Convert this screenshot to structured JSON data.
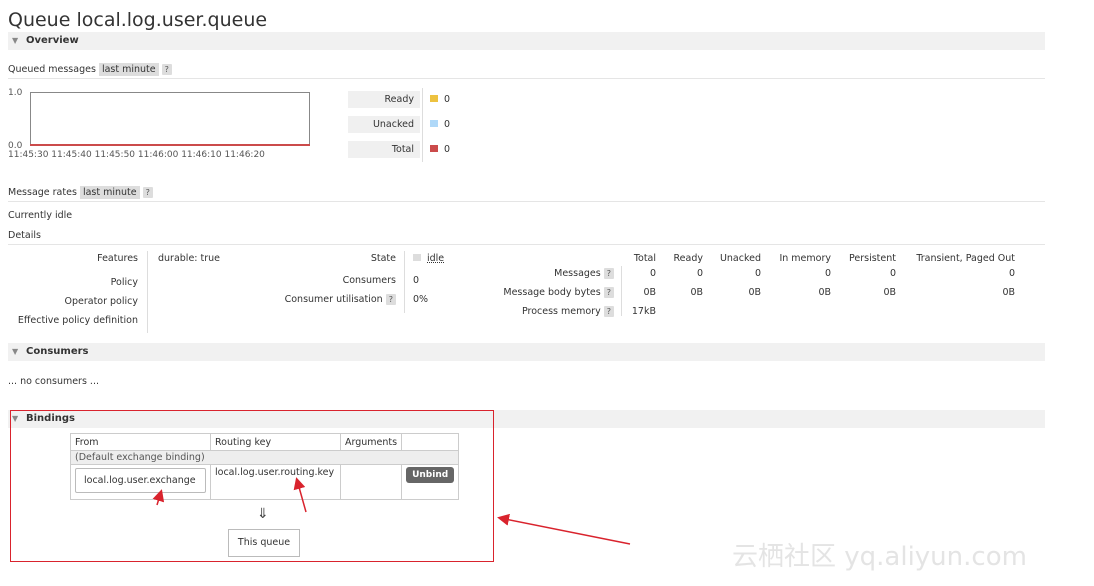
{
  "title_prefix": "Queue",
  "title_name": "local.log.user.queue",
  "overview": {
    "label": "Overview",
    "queued_label": "Queued messages",
    "queued_range": "last minute",
    "help": "?",
    "y_top": "1.0",
    "y_bottom": "0.0",
    "x_ticks": [
      "11:45:30",
      "11:45:40",
      "11:45:50",
      "11:46:00",
      "11:46:10",
      "11:46:20"
    ],
    "legend": [
      {
        "label": "Ready",
        "value": "0",
        "color": "#edc240"
      },
      {
        "label": "Unacked",
        "value": "0",
        "color": "#afd8f8"
      },
      {
        "label": "Total",
        "value": "0",
        "color": "#cb4b4b"
      }
    ],
    "rates_label": "Message rates",
    "rates_range": "last minute",
    "currently_idle": "Currently idle",
    "details": "Details"
  },
  "details": {
    "features_label": "Features",
    "features_value": "durable: true",
    "policy_label": "Policy",
    "operator_policy_label": "Operator policy",
    "effective_policy_label": "Effective policy definition",
    "state_label": "State",
    "state_value": "idle",
    "consumers_label": "Consumers",
    "consumers_value": "0",
    "util_label": "Consumer utilisation",
    "util_value": "0%",
    "columns": [
      "Total",
      "Ready",
      "Unacked",
      "In memory",
      "Persistent",
      "Transient, Paged Out"
    ],
    "messages_label": "Messages",
    "messages": [
      "0",
      "0",
      "0",
      "0",
      "0",
      "0"
    ],
    "body_bytes_label": "Message body bytes",
    "body_bytes": [
      "0B",
      "0B",
      "0B",
      "0B",
      "0B",
      "0B"
    ],
    "process_memory_label": "Process memory",
    "process_memory": "17kB"
  },
  "consumers": {
    "label": "Consumers",
    "empty": "... no consumers ..."
  },
  "bindings": {
    "label": "Bindings",
    "headers": [
      "From",
      "Routing key",
      "Arguments",
      ""
    ],
    "default_binding": "(Default exchange binding)",
    "exchange": "local.log.user.exchange",
    "routing_key": "local.log.user.routing.key",
    "unbind": "Unbind",
    "arrow": "⇓",
    "this_queue": "This queue"
  },
  "watermark": "云栖社区 yq.aliyun.com",
  "colors": {
    "annotation": "#d9232d"
  }
}
